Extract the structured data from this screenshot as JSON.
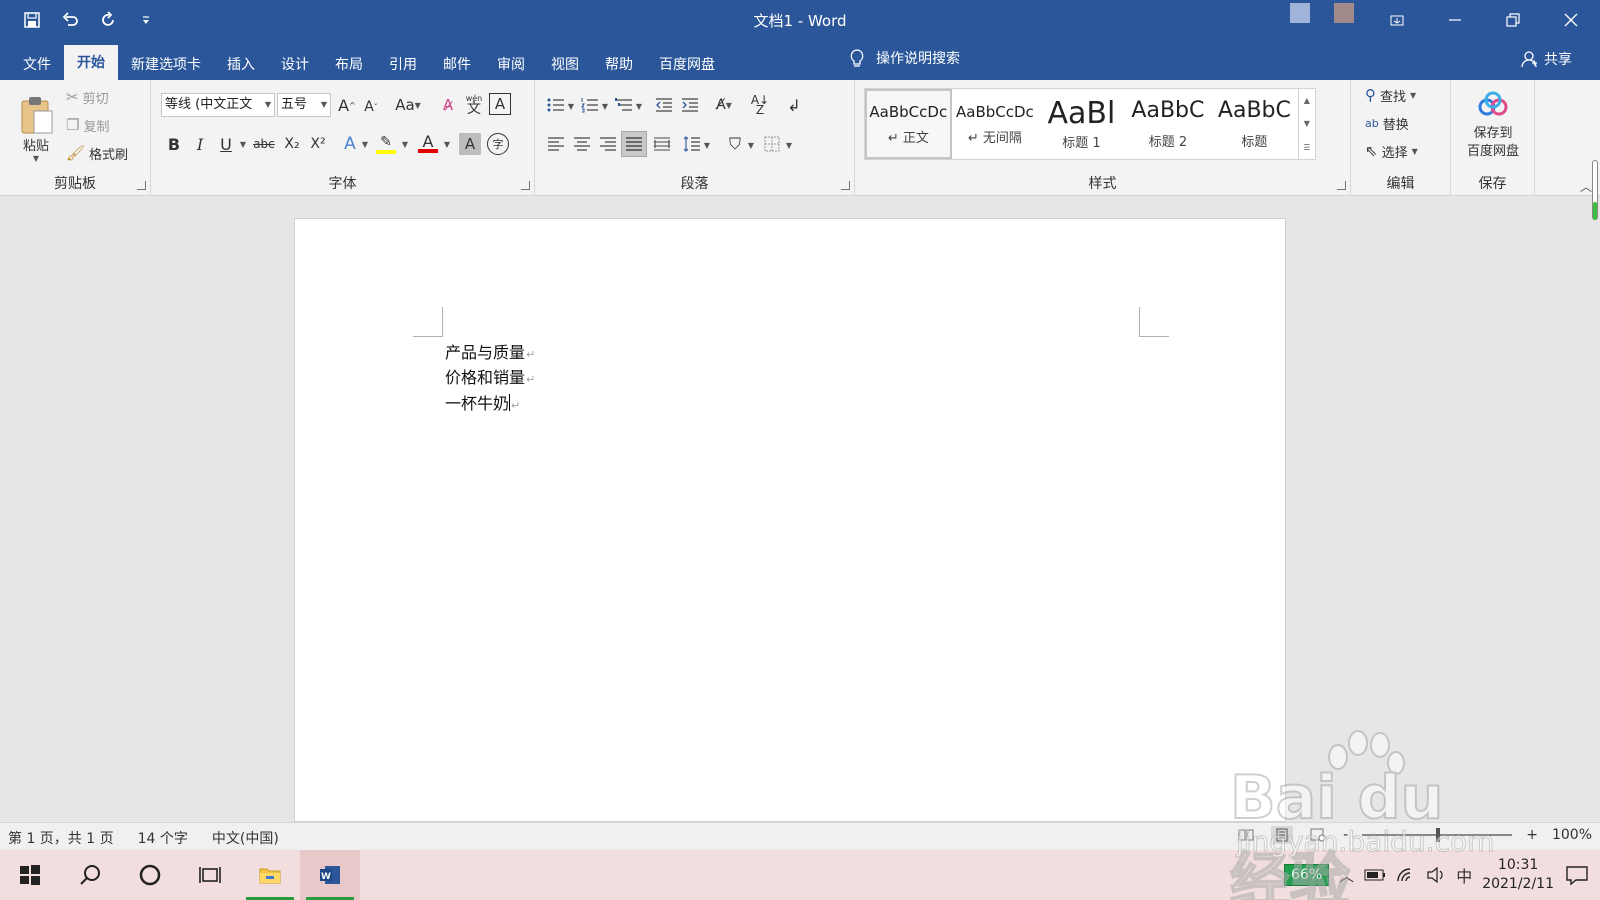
{
  "app": {
    "title": "文档1  -  Word"
  },
  "tabs": [
    {
      "label": "文件"
    },
    {
      "label": "开始"
    },
    {
      "label": "新建选项卡"
    },
    {
      "label": "插入"
    },
    {
      "label": "设计"
    },
    {
      "label": "布局"
    },
    {
      "label": "引用"
    },
    {
      "label": "邮件"
    },
    {
      "label": "审阅"
    },
    {
      "label": "视图"
    },
    {
      "label": "帮助"
    },
    {
      "label": "百度网盘"
    }
  ],
  "tell_me": "操作说明搜索",
  "share": "共享",
  "ribbon": {
    "clipboard": {
      "paste": "粘贴",
      "cut": "剪切",
      "copy": "复制",
      "format_painter": "格式刷",
      "label": "剪贴板"
    },
    "font": {
      "font_name": "等线 (中文正文",
      "font_size": "五号",
      "change_case": "Aa",
      "bold": "B",
      "italic": "I",
      "underline": "U",
      "strike": "abc",
      "subscript": "X₂",
      "superscript": "X²",
      "text_effects": "A",
      "font_color": "A",
      "char_shading": "A",
      "phonetic": "文",
      "phonetic_top": "wén",
      "char_border": "A",
      "enclose": "字",
      "label": "字体"
    },
    "paragraph": {
      "label": "段落"
    },
    "styles": {
      "items": [
        {
          "preview": "AaBbCcDc",
          "name": "↵ 正文"
        },
        {
          "preview": "AaBbCcDc",
          "name": "↵ 无间隔"
        },
        {
          "preview": "AaBl",
          "name": "标题 1"
        },
        {
          "preview": "AaBbC",
          "name": "标题 2"
        },
        {
          "preview": "AaBbC",
          "name": "标题"
        }
      ],
      "label": "样式"
    },
    "editing": {
      "find": "查找",
      "replace": "替换",
      "select": "选择",
      "label": "编辑"
    },
    "save": {
      "button": "保存到\n百度网盘",
      "label": "保存"
    }
  },
  "document": {
    "paragraphs": [
      {
        "text": "产品与质量"
      },
      {
        "text": "价格和销量"
      },
      {
        "text": "一杯牛奶"
      }
    ],
    "para_mark": "↵"
  },
  "status": {
    "page": "第 1 页，共 1 页",
    "words": "14 个字",
    "language": "中文(中国)",
    "zoom": "100%",
    "zoom_minus": "-",
    "zoom_plus": "+"
  },
  "taskbar": {
    "battery": "66%",
    "ime": "中",
    "time": "10:31",
    "date": "2021/2/11"
  },
  "watermark": {
    "brand": "Bai du 经验",
    "url": "jingyan.baidu.com"
  },
  "colors": {
    "word_blue": "#2b579a",
    "ribbon_bg": "#f3f3f3",
    "highlight_yellow": "#ffff00",
    "font_red": "#e00000",
    "battery_green": "#22a050"
  }
}
